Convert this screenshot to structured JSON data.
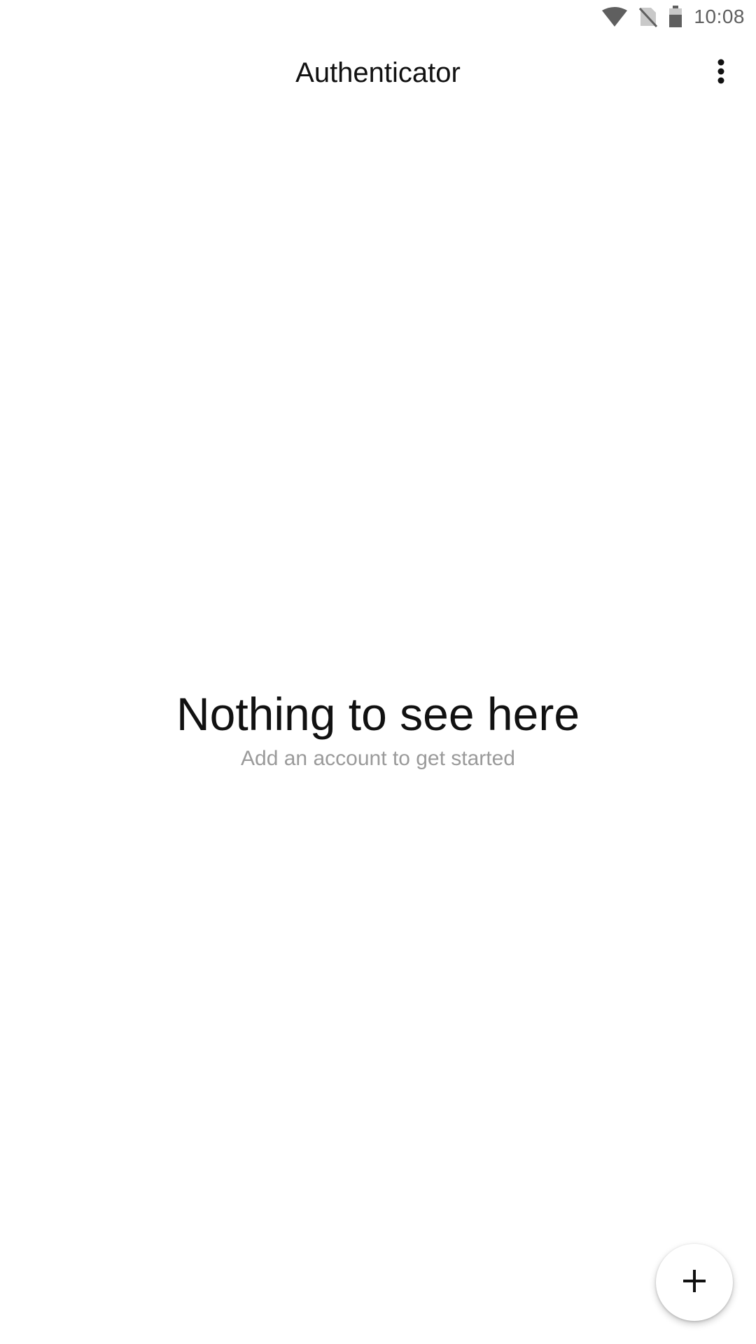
{
  "status_bar": {
    "time": "10:08",
    "icons": [
      "wifi-icon",
      "no-sim-icon",
      "battery-icon"
    ]
  },
  "app_bar": {
    "title": "Authenticator",
    "menu_icon": "more-vert-icon"
  },
  "empty_state": {
    "title": "Nothing to see here",
    "subtitle": "Add an account to get started"
  },
  "fab": {
    "icon": "plus-icon"
  },
  "colors": {
    "background": "#ffffff",
    "text_primary": "#111111",
    "text_secondary": "#9a9a9a",
    "status_icons": "#5f5f5f"
  }
}
